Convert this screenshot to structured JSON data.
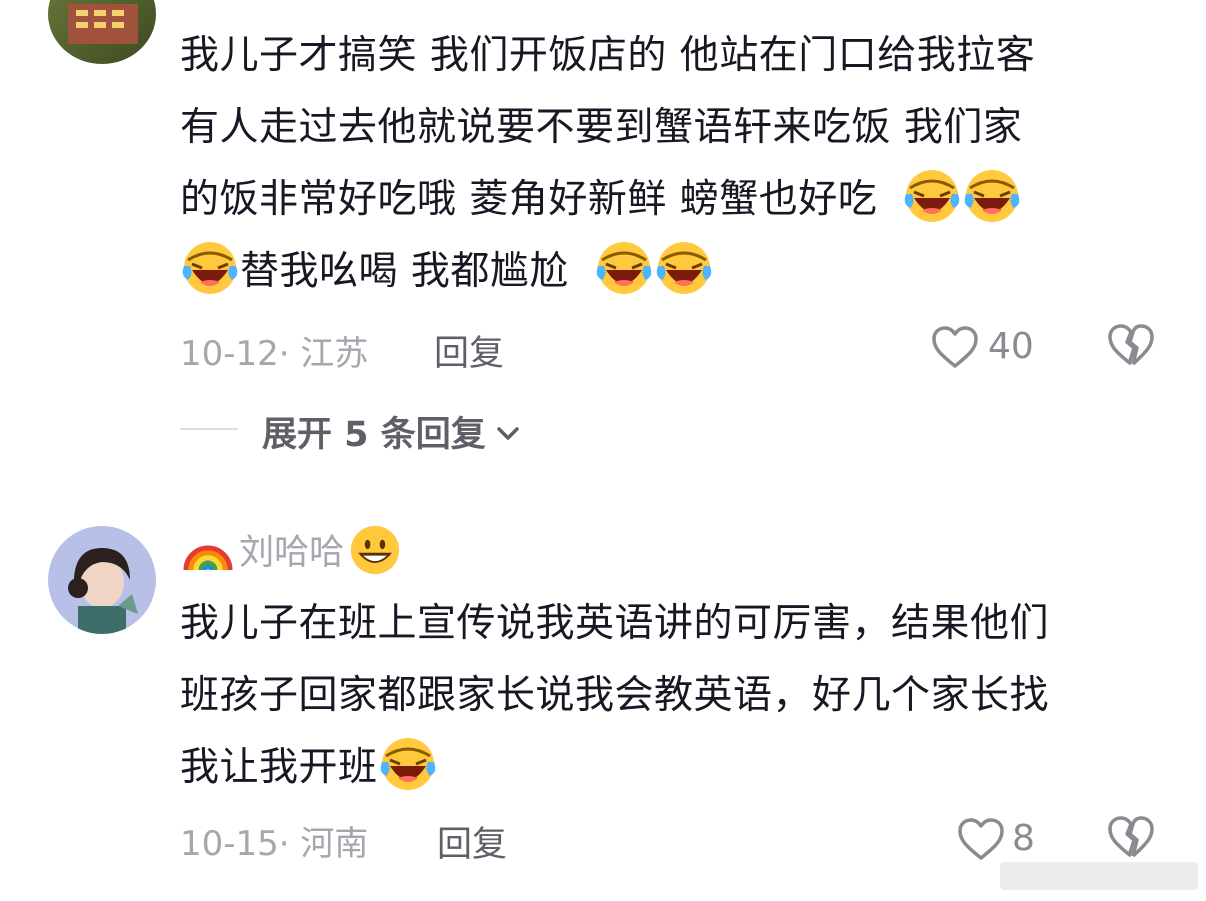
{
  "comments": [
    {
      "text_lines": [
        "我儿子才搞笑 我们开饭店的 他站在门口给我拉客",
        "有人走过去他就说要不要到蟹语轩来吃饭 我们家",
        "的饭非常好吃哦 菱角好新鲜 螃蟹也好吃",
        "替我吆喝 我都尴尬"
      ],
      "date_location": "10-12· 江苏",
      "reply_label": "回复",
      "likes": "40",
      "expand_label": "展开 5 条回复"
    },
    {
      "username": "刘哈哈",
      "text_lines": [
        "我儿子在班上宣传说我英语讲的可厉害，结果他们",
        "班孩子回家都跟家长说我会教英语，好几个家长找",
        "我让我开班"
      ],
      "date_location": "10-15· 河南",
      "reply_label": "回复",
      "likes": "8"
    }
  ],
  "icons": {
    "like": "heart-outline-icon",
    "dislike": "broken-heart-icon",
    "expand": "chevron-down-icon",
    "emoji_laugh": "rolling-laughing-emoji",
    "emoji_grin": "grinning-emoji",
    "rainbow": "rainbow-emoji"
  },
  "colors": {
    "text": "#161823",
    "meta": "#a5a7ae",
    "reply": "#5f6067",
    "emoji_yellow": "#ffc83d"
  }
}
